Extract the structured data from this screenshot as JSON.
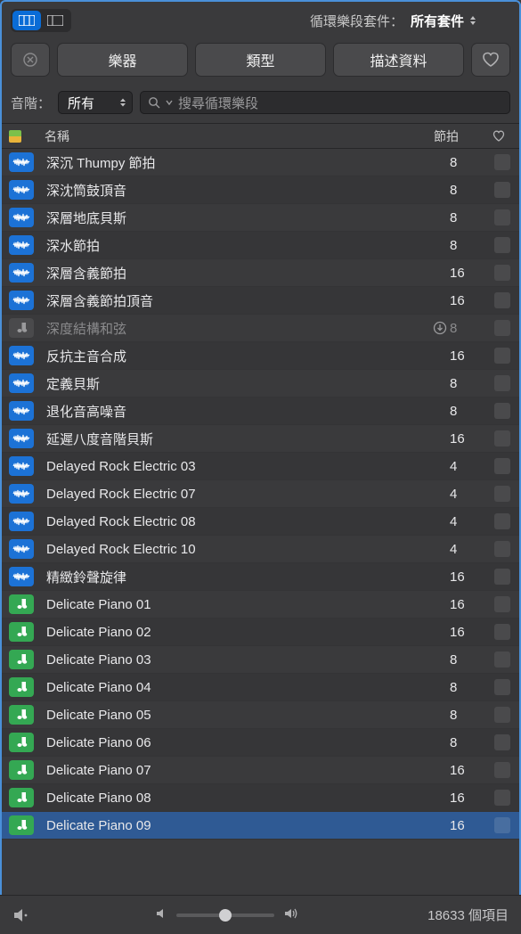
{
  "toolbar": {
    "pack_label": "循環樂段套件：",
    "pack_value": "所有套件"
  },
  "filters": {
    "instruments": "樂器",
    "types": "類型",
    "descriptors": "描述資料"
  },
  "scale": {
    "label": "音階：",
    "value": "所有"
  },
  "search": {
    "placeholder": "搜尋循環樂段"
  },
  "columns": {
    "name": "名稱",
    "beats": "節拍"
  },
  "loops": [
    {
      "kind": "audio",
      "name": "深沉 Thumpy 節拍",
      "beats": "8"
    },
    {
      "kind": "audio",
      "name": "深沈筒鼓頂音",
      "beats": "8"
    },
    {
      "kind": "audio",
      "name": "深層地底貝斯",
      "beats": "8"
    },
    {
      "kind": "audio",
      "name": "深水節拍",
      "beats": "8"
    },
    {
      "kind": "audio",
      "name": "深層含義節拍",
      "beats": "16"
    },
    {
      "kind": "audio",
      "name": "深層含義節拍頂音",
      "beats": "16"
    },
    {
      "kind": "dim",
      "name": "深度結構和弦",
      "beats": "8",
      "download": true,
      "dimmed": true
    },
    {
      "kind": "audio",
      "name": "反抗主音合成",
      "beats": "16"
    },
    {
      "kind": "audio",
      "name": "定義貝斯",
      "beats": "8"
    },
    {
      "kind": "audio",
      "name": "退化音高噪音",
      "beats": "8"
    },
    {
      "kind": "audio",
      "name": "延遲八度音階貝斯",
      "beats": "16"
    },
    {
      "kind": "audio",
      "name": "Delayed Rock Electric 03",
      "beats": "4"
    },
    {
      "kind": "audio",
      "name": "Delayed Rock Electric 07",
      "beats": "4"
    },
    {
      "kind": "audio",
      "name": "Delayed Rock Electric 08",
      "beats": "4"
    },
    {
      "kind": "audio",
      "name": "Delayed Rock Electric 10",
      "beats": "4"
    },
    {
      "kind": "audio",
      "name": "精緻鈴聲旋律",
      "beats": "16"
    },
    {
      "kind": "midi",
      "name": "Delicate Piano 01",
      "beats": "16"
    },
    {
      "kind": "midi",
      "name": "Delicate Piano 02",
      "beats": "16"
    },
    {
      "kind": "midi",
      "name": "Delicate Piano 03",
      "beats": "8"
    },
    {
      "kind": "midi",
      "name": "Delicate Piano 04",
      "beats": "8"
    },
    {
      "kind": "midi",
      "name": "Delicate Piano 05",
      "beats": "8"
    },
    {
      "kind": "midi",
      "name": "Delicate Piano 06",
      "beats": "8"
    },
    {
      "kind": "midi",
      "name": "Delicate Piano 07",
      "beats": "16"
    },
    {
      "kind": "midi",
      "name": "Delicate Piano 08",
      "beats": "16"
    },
    {
      "kind": "midi",
      "name": "Delicate Piano 09",
      "beats": "16",
      "selected": true
    }
  ],
  "footer": {
    "item_count": "18633 個項目"
  }
}
